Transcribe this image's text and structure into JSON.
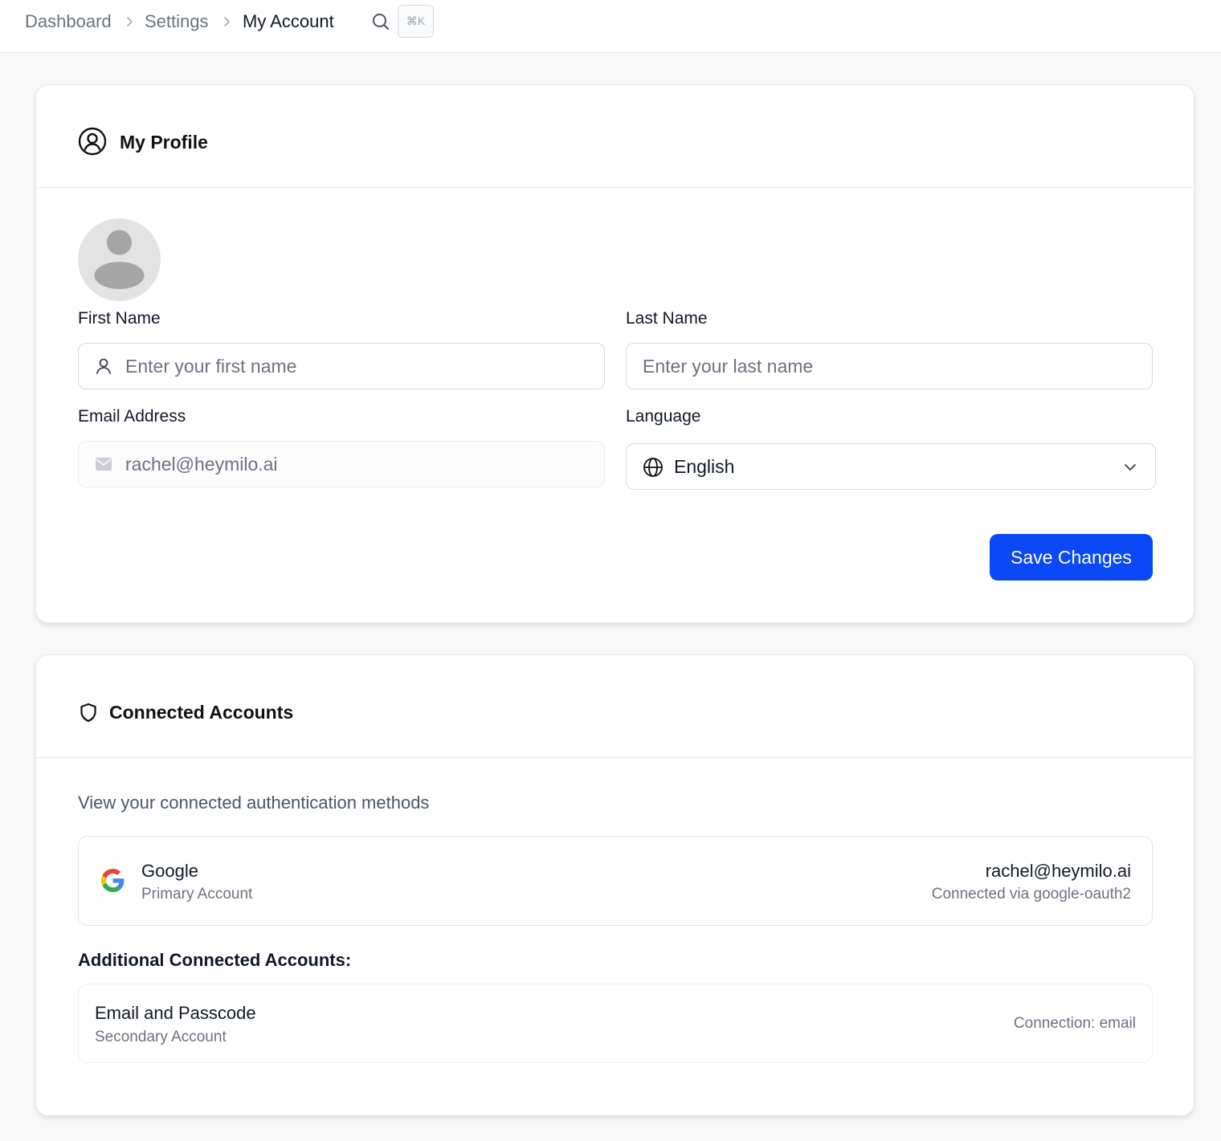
{
  "breadcrumb": {
    "items": [
      "Dashboard",
      "Settings",
      "My Account"
    ],
    "shortcut": "⌘K"
  },
  "profile": {
    "title": "My Profile",
    "first_name": {
      "label": "First Name",
      "placeholder": "Enter your first name",
      "value": ""
    },
    "last_name": {
      "label": "Last Name",
      "placeholder": "Enter your last name",
      "value": ""
    },
    "email": {
      "label": "Email Address",
      "value": "rachel@heymilo.ai"
    },
    "language": {
      "label": "Language",
      "selected": "English"
    },
    "save_label": "Save Changes"
  },
  "connected": {
    "title": "Connected Accounts",
    "description": "View your connected authentication methods",
    "primary": {
      "provider": "Google",
      "role": "Primary Account",
      "email": "rachel@heymilo.ai",
      "via": "Connected via google-oauth2",
      "icon": "google-icon"
    },
    "additional_heading": "Additional Connected Accounts:",
    "additional": [
      {
        "name": "Email and Passcode",
        "role": "Secondary Account",
        "connection": "Connection: email"
      }
    ]
  },
  "colors": {
    "accent": "#0a49f5",
    "page_bg": "#f8f8f9",
    "border": "#e6e8ec",
    "muted_text": "#6b7280"
  }
}
